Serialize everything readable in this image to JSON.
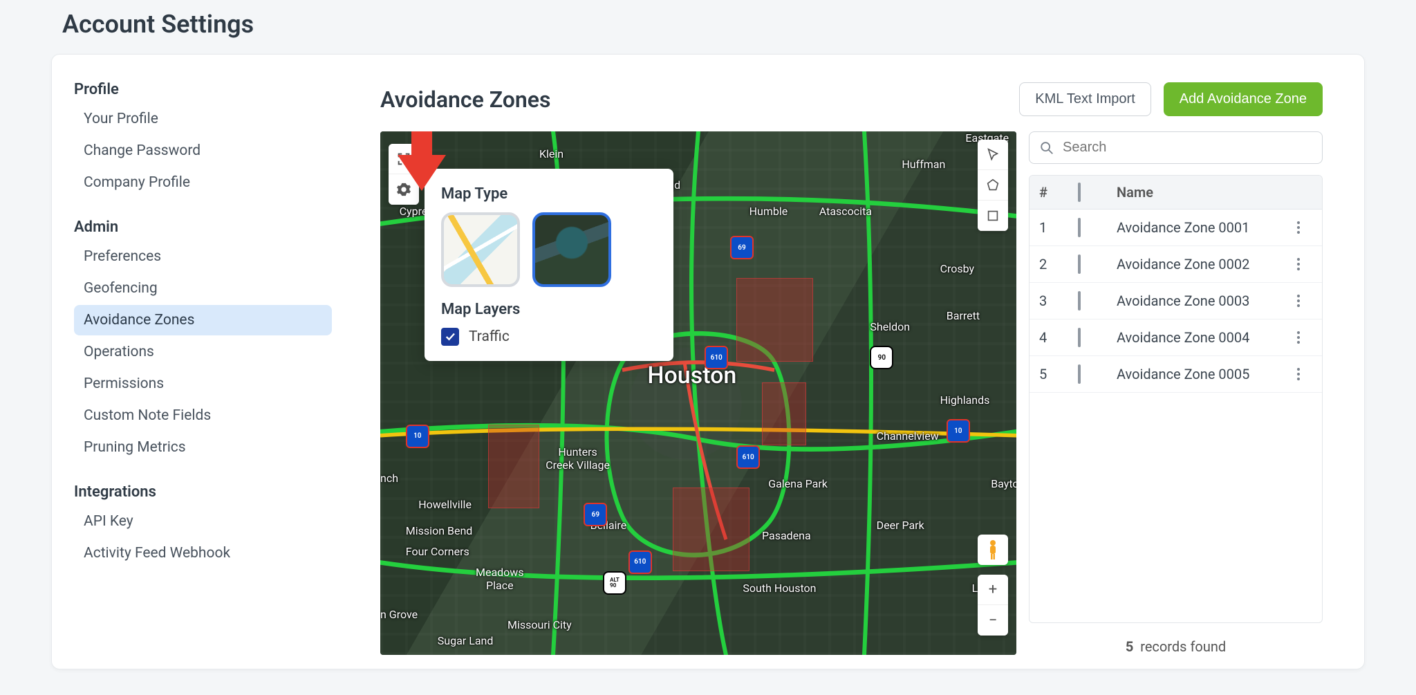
{
  "page_title": "Account Settings",
  "sidebar": {
    "groups": [
      {
        "title": "Profile",
        "items": [
          {
            "label": "Your Profile",
            "active": false
          },
          {
            "label": "Change Password",
            "active": false
          },
          {
            "label": "Company Profile",
            "active": false
          }
        ]
      },
      {
        "title": "Admin",
        "items": [
          {
            "label": "Preferences",
            "active": false
          },
          {
            "label": "Geofencing",
            "active": false
          },
          {
            "label": "Avoidance Zones",
            "active": true
          },
          {
            "label": "Operations",
            "active": false
          },
          {
            "label": "Permissions",
            "active": false
          },
          {
            "label": "Custom Note Fields",
            "active": false
          },
          {
            "label": "Pruning Metrics",
            "active": false
          }
        ]
      },
      {
        "title": "Integrations",
        "items": [
          {
            "label": "API Key",
            "active": false
          },
          {
            "label": "Activity Feed Webhook",
            "active": false
          }
        ]
      }
    ]
  },
  "main": {
    "title": "Avoidance Zones",
    "kml_button": "KML Text Import",
    "add_button": "Add Avoidance Zone"
  },
  "popover": {
    "map_type_title": "Map Type",
    "map_layers_title": "Map Layers",
    "traffic_label": "Traffic",
    "traffic_checked": true,
    "selected_type": "satellite"
  },
  "map_labels": {
    "houston": "Houston",
    "klein": "Klein",
    "westfield": "Westfield",
    "huffman": "Huffman",
    "eastgate": "Eastgate",
    "cypress": "Cypress",
    "humble": "Humble",
    "atascocita": "Atascocita",
    "crosby": "Crosby",
    "sheldon": "Sheldon",
    "barrett": "Barrett",
    "highlands": "Highlands",
    "channelview": "Channelview",
    "bayto": "Bayto",
    "hunters": "Hunters\nCreek Village",
    "bellaire": "Bellaire",
    "pasadena": "Pasadena",
    "galenapark": "Galena Park",
    "deerpark": "Deer Park",
    "southhouston": "South Houston",
    "la": "La",
    "howellville": "Howellville",
    "missionbend": "Mission Bend",
    "fourcorners": "Four Corners",
    "meadows": "Meadows\nPlace",
    "missouricity": "Missouri City",
    "sugarland": "Sugar Land",
    "ngrove": "n Grove",
    "nch": "nch"
  },
  "shields": {
    "i10": "10",
    "i69": "69",
    "i610": "610",
    "us90": "90",
    "alt90": "ALT\n90"
  },
  "search": {
    "placeholder": "Search"
  },
  "zones_table": {
    "headers": {
      "num": "#",
      "name": "Name"
    },
    "rows": [
      {
        "num": "1",
        "name": "Avoidance Zone 0001"
      },
      {
        "num": "2",
        "name": "Avoidance Zone 0002"
      },
      {
        "num": "3",
        "name": "Avoidance Zone 0003"
      },
      {
        "num": "4",
        "name": "Avoidance Zone 0004"
      },
      {
        "num": "5",
        "name": "Avoidance Zone 0005"
      }
    ],
    "count": "5",
    "records_label": "records found"
  },
  "zoom": {
    "in": "+",
    "out": "−"
  }
}
